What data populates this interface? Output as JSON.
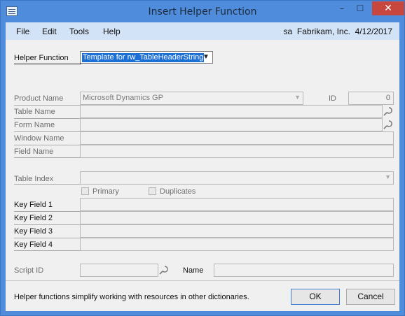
{
  "window": {
    "title": "Insert Helper Function",
    "controls": {
      "minimize": "–",
      "maximize": "☐",
      "close": "✕"
    }
  },
  "menu": {
    "items": [
      "File",
      "Edit",
      "Tools",
      "Help"
    ],
    "user": "sa",
    "company": "Fabrikam, Inc.",
    "date": "4/12/2017"
  },
  "helper_function": {
    "label": "Helper Function",
    "value": "Template for rw_TableHeaderString",
    "arrow": "▼"
  },
  "resource": {
    "product_name_label": "Product Name",
    "product_name_value": "Microsoft Dynamics GP",
    "id_label": "ID",
    "id_value": "0",
    "table_name_label": "Table Name",
    "form_name_label": "Form Name",
    "window_name_label": "Window Name",
    "field_name_label": "Field Name"
  },
  "index": {
    "table_index_label": "Table Index",
    "primary_label": "Primary",
    "duplicates_label": "Duplicates",
    "key_field_1_label": "Key Field 1",
    "key_field_2_label": "Key Field 2",
    "key_field_3_label": "Key Field 3",
    "key_field_4_label": "Key Field 4"
  },
  "script": {
    "script_id_label": "Script ID",
    "name_label": "Name"
  },
  "footer": {
    "help_text": "Helper functions simplify working with resources in other dictionaries.",
    "ok_label": "OK",
    "cancel_label": "Cancel"
  },
  "colors": {
    "title_bar": "#4f8ddc",
    "menu_bar": "#d3e3f7",
    "selection": "#1c6fd4",
    "close_button": "#c7463e"
  }
}
